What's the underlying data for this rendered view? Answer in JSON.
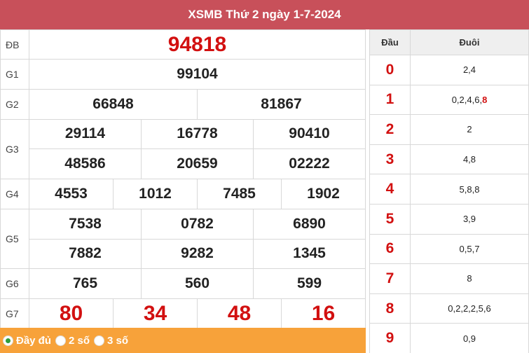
{
  "header": {
    "title": "XSMB Thứ 2 ngày 1-7-2024"
  },
  "results": {
    "db": {
      "label": "ĐB",
      "value": "94818"
    },
    "g1": {
      "label": "G1",
      "values": [
        "99104"
      ]
    },
    "g2": {
      "label": "G2",
      "values": [
        "66848",
        "81867"
      ]
    },
    "g3": {
      "label": "G3",
      "values": [
        "29114",
        "16778",
        "90410",
        "48586",
        "20659",
        "02222"
      ]
    },
    "g4": {
      "label": "G4",
      "values": [
        "4553",
        "1012",
        "7485",
        "1902"
      ]
    },
    "g5": {
      "label": "G5",
      "values": [
        "7538",
        "0782",
        "6890",
        "7882",
        "9282",
        "1345"
      ]
    },
    "g6": {
      "label": "G6",
      "values": [
        "765",
        "560",
        "599"
      ]
    },
    "g7": {
      "label": "G7",
      "values": [
        "80",
        "34",
        "48",
        "16"
      ]
    }
  },
  "footer": {
    "options": [
      {
        "label": "Đầy đủ",
        "checked": true
      },
      {
        "label": "2 số",
        "checked": false
      },
      {
        "label": "3 số",
        "checked": false
      }
    ]
  },
  "loto": {
    "head_label": "Đầu",
    "tail_label": "Đuôi",
    "rows": [
      {
        "head": "0",
        "tail": "2,4",
        "tail_hl": ""
      },
      {
        "head": "1",
        "tail": "0,2,4,6,",
        "tail_hl": "8"
      },
      {
        "head": "2",
        "tail": "2",
        "tail_hl": ""
      },
      {
        "head": "3",
        "tail": "4,8",
        "tail_hl": ""
      },
      {
        "head": "4",
        "tail": "5,8,8",
        "tail_hl": ""
      },
      {
        "head": "5",
        "tail": "3,9",
        "tail_hl": ""
      },
      {
        "head": "6",
        "tail": "0,5,7",
        "tail_hl": ""
      },
      {
        "head": "7",
        "tail": "8",
        "tail_hl": ""
      },
      {
        "head": "8",
        "tail": "0,2,2,2,5,6",
        "tail_hl": ""
      },
      {
        "head": "9",
        "tail": "0,9",
        "tail_hl": ""
      }
    ],
    "highlight_color": "#d21010"
  },
  "colors": {
    "header_bg": "#c8505a",
    "footer_bg": "#f7a23a",
    "prize_red": "#d21010"
  }
}
